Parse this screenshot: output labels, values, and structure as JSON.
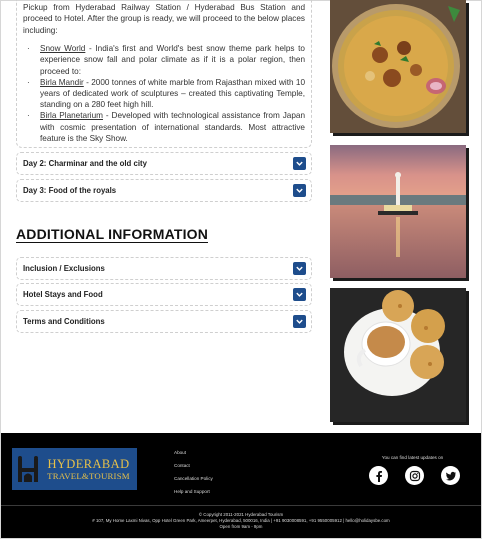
{
  "day1": {
    "intro": "Pickup from Hyderabad Railway Station / Hyderabad Bus Station and proceed to Hotel. After the group is ready, we will proceed  to the below places including:",
    "places": [
      {
        "name": "Snow World",
        "text": " - India's first and World's best snow theme park helps to experience snow fall and polar climate as if it is a polar region, then proceed to:"
      },
      {
        "name": "Birla Mandir",
        "text": " - 2000 tonnes of white marble from Rajasthan mixed with 10 years of dedicated work of sculptures – created this captivating Temple, standing on a 280 feet high hill."
      },
      {
        "name": "Birla Planetarium",
        "text": " - Developed with technological assistance from Japan with cosmic presentation of international standards. Most attractive feature is the Sky Show."
      }
    ]
  },
  "itinerary": [
    {
      "label": "Day 2: Charminar and the old city"
    },
    {
      "label": "Day 3: Food of the royals"
    }
  ],
  "additional": {
    "title": "ADDITIONAL INFORMATION",
    "items": [
      {
        "label": "Inclusion / Exclusions"
      },
      {
        "label": "Hotel Stays and Food"
      },
      {
        "label": "Terms and Conditions"
      }
    ]
  },
  "footer": {
    "logo": {
      "line1": "HYDERABAD",
      "line2": "TRAVEL&TOURISM"
    },
    "links": [
      "About",
      "Contact",
      "Cancellation Policy",
      "Help and Support"
    ],
    "social_caption": "You can find latest updates on",
    "social_icons": [
      "facebook-icon",
      "instagram-icon",
      "twitter-icon"
    ],
    "copyright": "© Copyright 2011-2021 Hyderabad Tourism",
    "address": "# 107, My Home Laxmi Nivas, Opp Hotel Green Park, Ameerpet, Hyderabad, 500016, India | +91 9030008591, +91 9550005912 | hello@holidaysbe.com",
    "hours": "Open from 9am - 9pm"
  },
  "colors": {
    "accent": "#1e4d8c",
    "logo_text": "#e6c04a",
    "footer_bg": "#000000"
  }
}
